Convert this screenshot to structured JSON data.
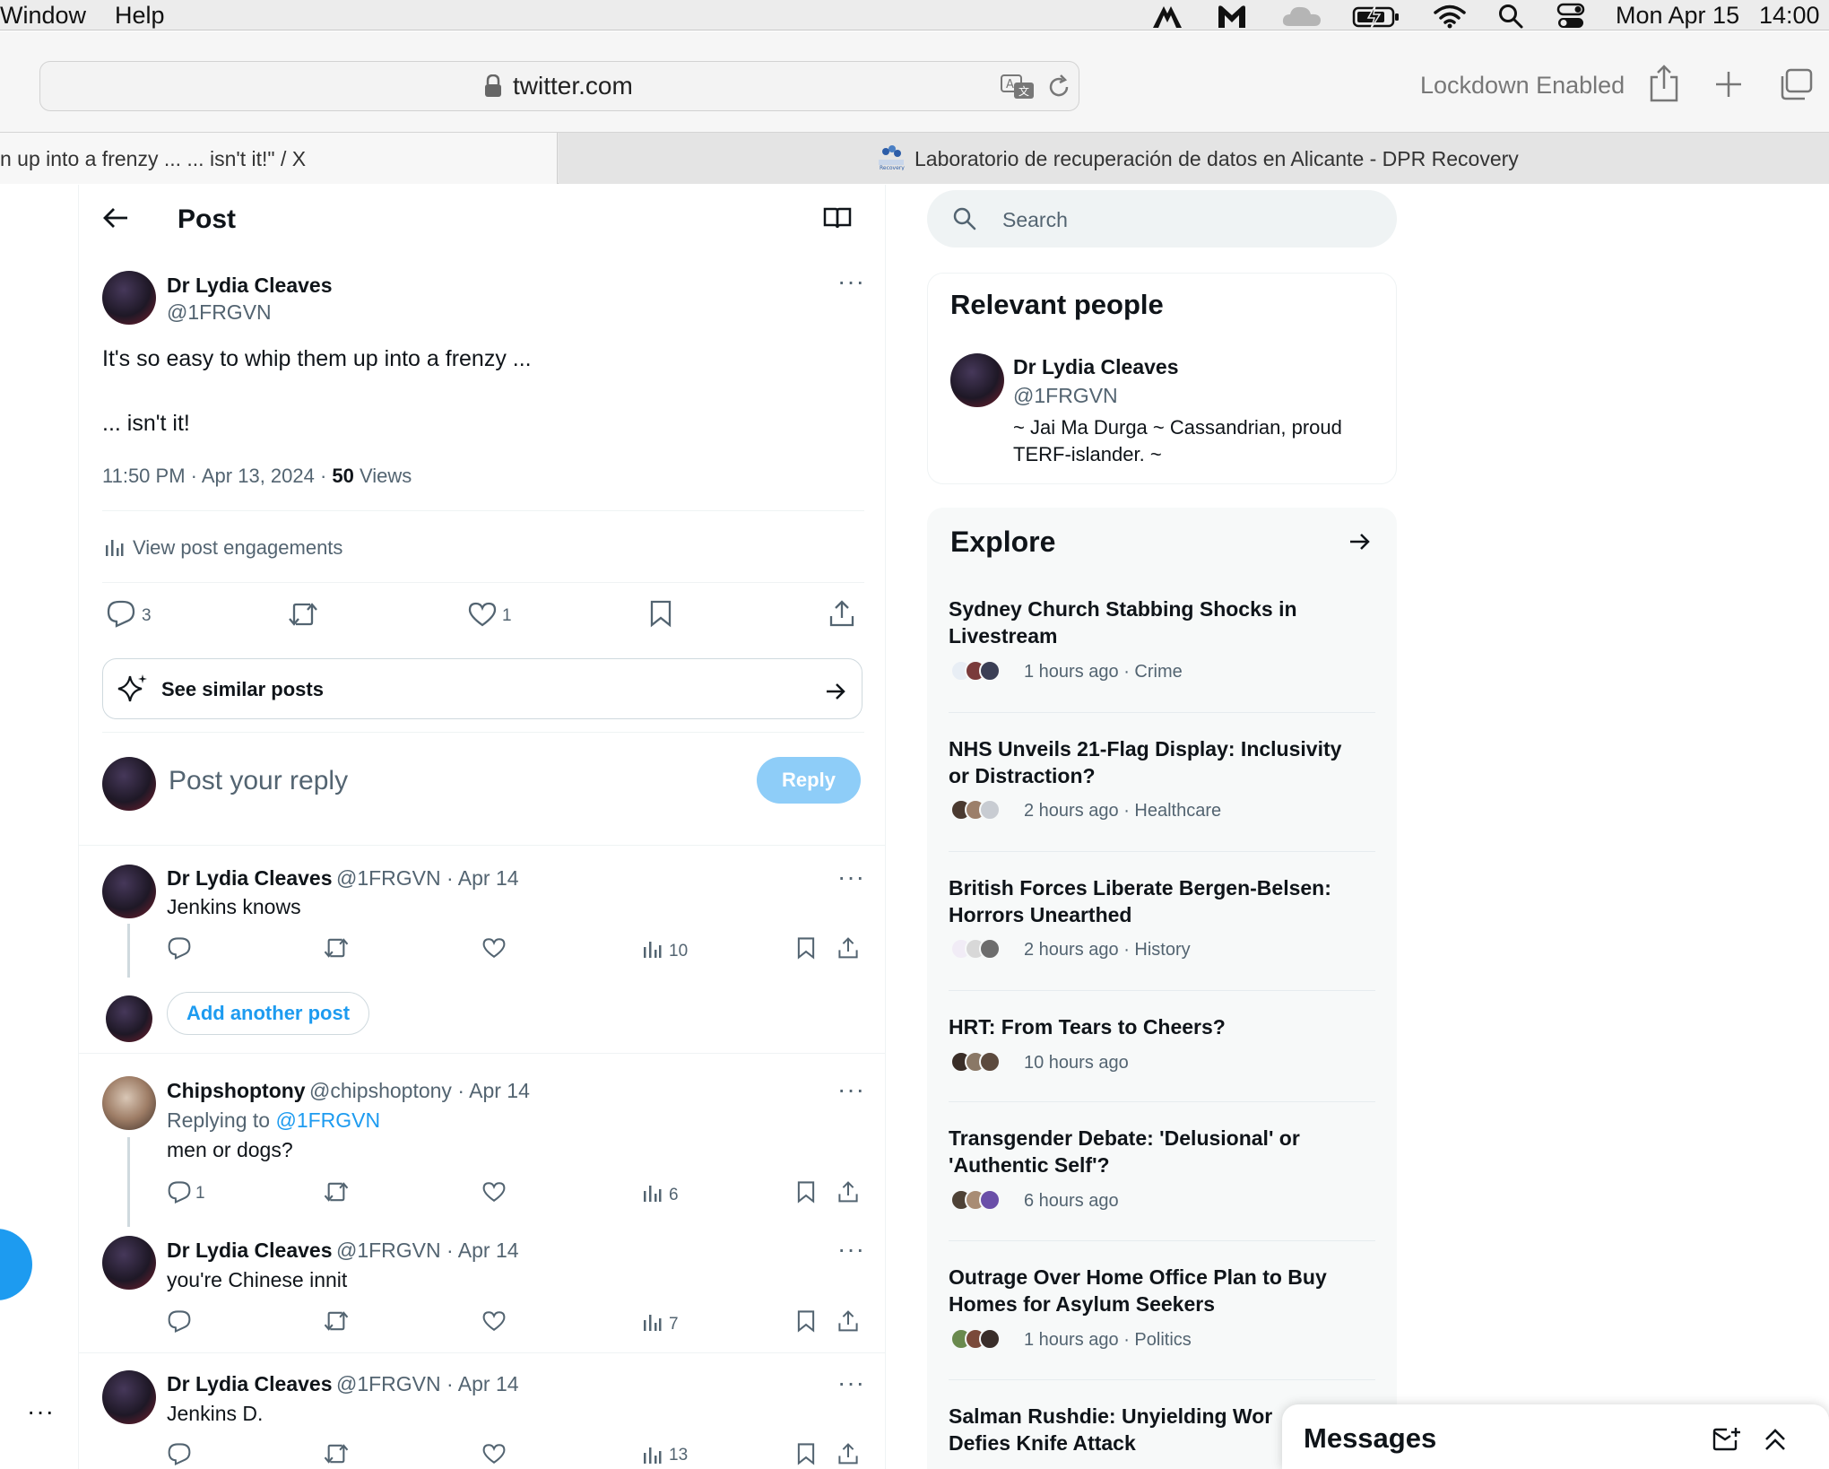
{
  "menubar": {
    "window_label": "Window",
    "help_label": "Help",
    "date": "Mon Apr 15",
    "time": "14:00"
  },
  "browser": {
    "url": "twitter.com",
    "lockdown": "Lockdown Enabled",
    "tabs": [
      {
        "title": "n up into a frenzy ... ... isn't it!\" / X"
      },
      {
        "title": "Laboratorio de recuperación de datos en Alicante - DPR Recovery"
      }
    ]
  },
  "post_header": {
    "title": "Post"
  },
  "main_post": {
    "author": "Dr Lydia Cleaves",
    "handle": "@1FRGVN",
    "line1": "It's so easy to whip them up into a frenzy ...",
    "line2": "... isn't it!",
    "meta": "11:50 PM · Apr 13, 2024 · ",
    "views_count": "50",
    "views_label": " Views",
    "engagements": "View post engagements",
    "reply_count": "3",
    "like_count": "1",
    "similar": "See similar posts"
  },
  "composer": {
    "placeholder": "Post your reply",
    "button": "Reply"
  },
  "replies": [
    {
      "author": "Dr Lydia Cleaves",
      "handle": "@1FRGVN · Apr 14",
      "text": "Jenkins knows",
      "views": "10",
      "replies": ""
    },
    {
      "author": "Chipshoptony",
      "handle": "@chipshoptony · Apr 14",
      "replying_prefix": "Replying to ",
      "replying_to": "@1FRGVN",
      "text": "men or dogs?",
      "views": "6",
      "replies": "1"
    },
    {
      "author": "Dr Lydia Cleaves",
      "handle": "@1FRGVN · Apr 14",
      "text": "you're Chinese innit",
      "views": "7",
      "replies": ""
    },
    {
      "author": "Dr Lydia Cleaves",
      "handle": "@1FRGVN · Apr 14",
      "text": "Jenkins D.",
      "views": "13",
      "replies": ""
    }
  ],
  "add_another": "Add another post",
  "search": {
    "placeholder": "Search"
  },
  "relevant_people": {
    "title": "Relevant people",
    "name": "Dr Lydia Cleaves",
    "handle": "@1FRGVN",
    "bio_line1": "~ Jai Ma Durga ~ Cassandrian, proud",
    "bio_line2": "TERF-islander. ~"
  },
  "explore": {
    "title": "Explore",
    "trends": [
      {
        "line1": "Sydney Church Stabbing Shocks in",
        "line2": "Livestream",
        "meta": "1 hours ago · Crime"
      },
      {
        "line1": "NHS Unveils 21-Flag Display: Inclusivity",
        "line2": "or Distraction?",
        "meta": "2 hours ago · Healthcare"
      },
      {
        "line1": "British Forces Liberate Bergen-Belsen:",
        "line2": "Horrors Unearthed",
        "meta": "2 hours ago · History"
      },
      {
        "line1": "HRT: From Tears to Cheers?",
        "line2": "",
        "meta": "10 hours ago"
      },
      {
        "line1": "Transgender Debate: 'Delusional' or",
        "line2": "'Authentic Self'?",
        "meta": "6 hours ago"
      },
      {
        "line1": "Outrage Over Home Office Plan to Buy",
        "line2": "Homes for Asylum Seekers",
        "meta": "1 hours ago · Politics"
      },
      {
        "line1": "Salman Rushdie: Unyielding Wor",
        "line2": "Defies Knife Attack",
        "meta": ""
      }
    ]
  },
  "messages": {
    "title": "Messages"
  },
  "colors": {
    "accent": "#1d9bf0",
    "reply_button_disabled": "#8ecdf8",
    "text": "#0f1419",
    "muted": "#536471"
  }
}
